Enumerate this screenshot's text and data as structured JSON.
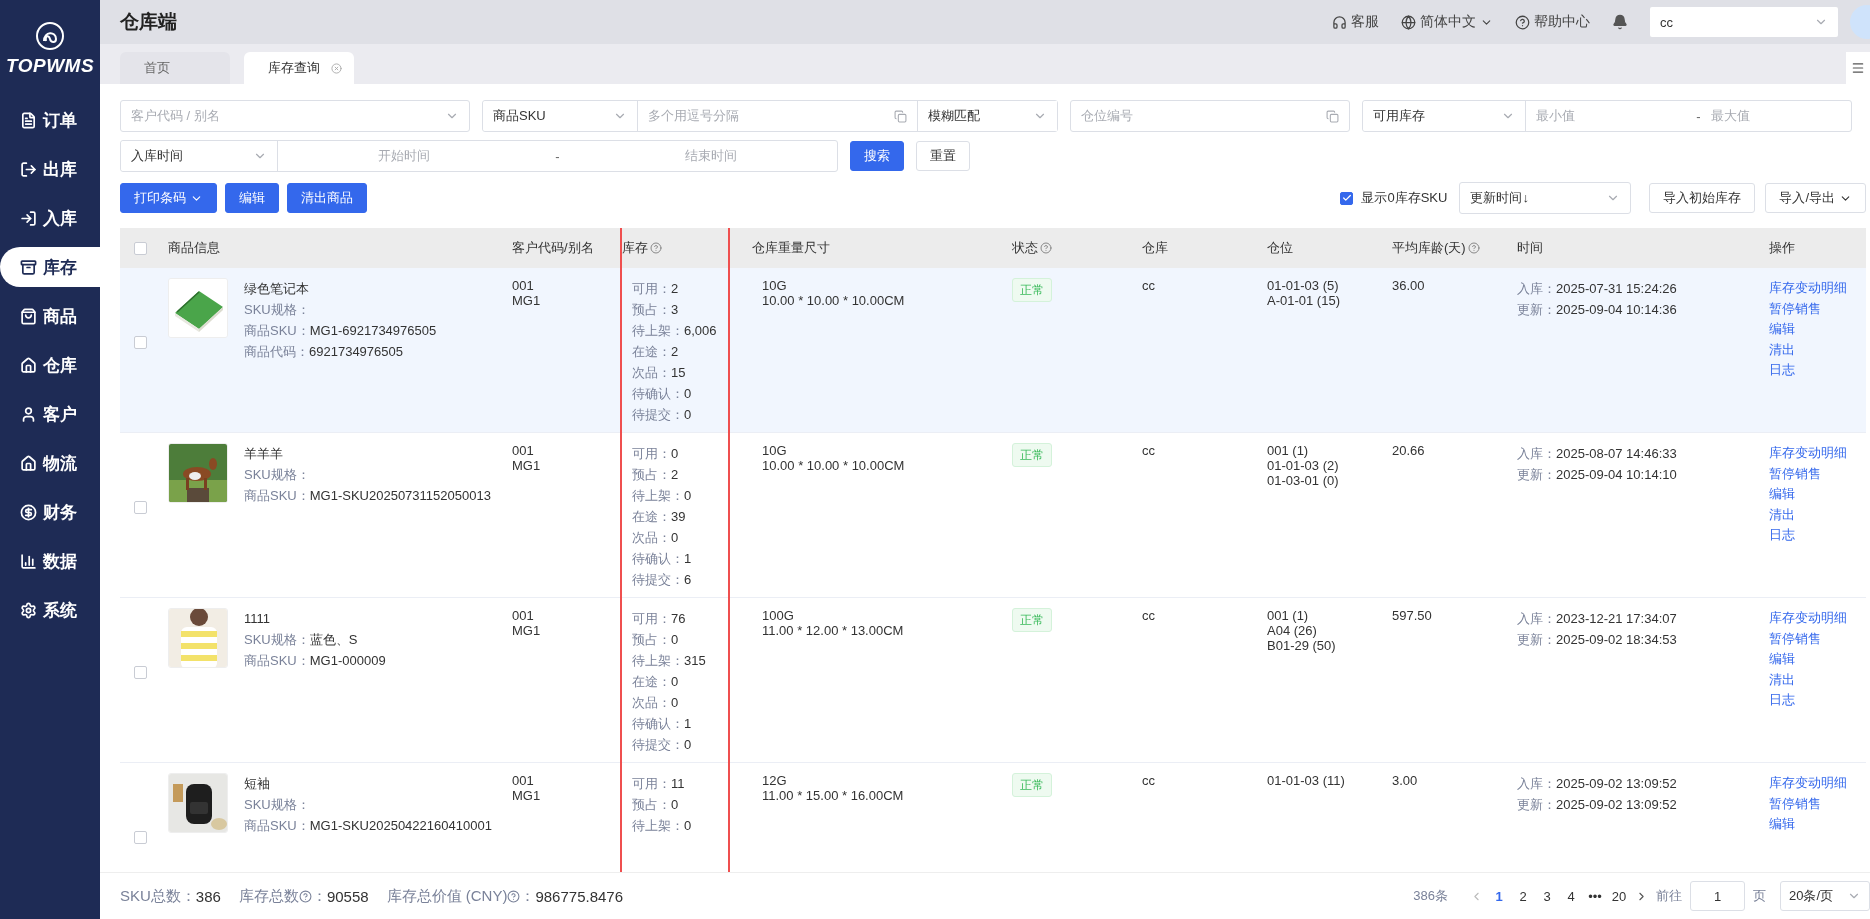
{
  "sidebar": {
    "logo": "TOPWMS",
    "items": [
      {
        "label": "订单",
        "selected": false
      },
      {
        "label": "出库",
        "selected": false
      },
      {
        "label": "入库",
        "selected": false
      },
      {
        "label": "库存",
        "selected": true
      },
      {
        "label": "商品",
        "selected": false
      },
      {
        "label": "仓库",
        "selected": false
      },
      {
        "label": "客户",
        "selected": false
      },
      {
        "label": "物流",
        "selected": false
      },
      {
        "label": "财务",
        "selected": false
      },
      {
        "label": "数据",
        "selected": false
      },
      {
        "label": "系统",
        "selected": false
      }
    ]
  },
  "header": {
    "title": "仓库端",
    "service": "客服",
    "language": "简体中文",
    "help": "帮助中心",
    "warehouse_select": {
      "value": "cc"
    }
  },
  "tabs": [
    {
      "label": "首页",
      "selected": false,
      "closable": false
    },
    {
      "label": "库存查询",
      "selected": true,
      "closable": true
    }
  ],
  "filters": {
    "customer": {
      "placeholder": "客户代码 / 别名"
    },
    "sku_type": {
      "value": "商品SKU"
    },
    "sku_input": {
      "placeholder": "多个用逗号分隔"
    },
    "match": {
      "value": "模糊匹配"
    },
    "location": {
      "placeholder": "仓位编号"
    },
    "stock_type": {
      "value": "可用库存"
    },
    "min": {
      "placeholder": "最小值"
    },
    "range_separator": "-",
    "max": {
      "placeholder": "最大值"
    },
    "date_type": {
      "value": "入库时间"
    },
    "start": {
      "placeholder": "开始时间"
    },
    "date_separator": "-",
    "end": {
      "placeholder": "结束时间"
    },
    "search_button": "搜索",
    "reset_button": "重置"
  },
  "toolbar": {
    "print_button": "打印条码",
    "edit_button": "编辑",
    "clear_button": "清出商品",
    "show_zero": {
      "label": "显示0库存SKU",
      "checked": true
    },
    "sort": {
      "value": "更新时间↓"
    },
    "import_initial_button": "导入初始库存",
    "import_export_button": "导入/导出"
  },
  "table": {
    "all_checked": false,
    "columns": [
      {
        "label": "商品信息",
        "help": false
      },
      {
        "label": "客户代码/别名",
        "help": false
      },
      {
        "label": "库存",
        "help": true
      },
      {
        "label": "仓库重量尺寸",
        "help": false
      },
      {
        "label": "状态",
        "help": true
      },
      {
        "label": "仓库",
        "help": false
      },
      {
        "label": "仓位",
        "help": false
      },
      {
        "label": "平均库龄(天)",
        "help": true
      },
      {
        "label": "时间",
        "help": false
      },
      {
        "label": "操作",
        "help": false
      }
    ],
    "rows": [
      {
        "highlighted": true,
        "checked": false,
        "product": {
          "name": "绿色笔记本",
          "lines": [
            {
              "label": "SKU规格："
            },
            {
              "label": "商品SKU：",
              "value": "MG1-6921734976505"
            },
            {
              "label": "商品代码：",
              "value": "6921734976505"
            }
          ]
        },
        "customer": [
          "001",
          "MG1"
        ],
        "stock": [
          {
            "label": "可用：",
            "value": "2"
          },
          {
            "label": "预占：",
            "value": "3"
          },
          {
            "label": "待上架：",
            "value": "6,006"
          },
          {
            "label": "在途：",
            "value": "2"
          },
          {
            "label": "次品：",
            "value": "15"
          },
          {
            "label": "待确认：",
            "value": "0"
          },
          {
            "label": "待提交：",
            "value": "0"
          }
        ],
        "weight": "10G",
        "dimensions": "10.00 * 10.00 * 10.00CM",
        "status": {
          "label": "正常",
          "kind": "normal"
        },
        "warehouse": "cc",
        "locations": [
          "01-01-03 (5)",
          "A-01-01 (15)"
        ],
        "age": "36.00",
        "times": [
          {
            "label": "入库：",
            "value": "2025-07-31 15:24:26"
          },
          {
            "label": "更新：",
            "value": "2025-09-04 10:14:36"
          }
        ],
        "actions": [
          "库存变动明细",
          "暂停销售",
          "编辑",
          "清出",
          "日志"
        ]
      },
      {
        "highlighted": false,
        "checked": false,
        "product": {
          "name": "羊羊羊",
          "lines": [
            {
              "label": "SKU规格："
            },
            {
              "label": "商品SKU：",
              "value": "MG1-SKU20250731152050013"
            }
          ]
        },
        "customer": [
          "001",
          "MG1"
        ],
        "stock": [
          {
            "label": "可用：",
            "value": "0"
          },
          {
            "label": "预占：",
            "value": "2"
          },
          {
            "label": "待上架：",
            "value": "0"
          },
          {
            "label": "在途：",
            "value": "39"
          },
          {
            "label": "次品：",
            "value": "0"
          },
          {
            "label": "待确认：",
            "value": "1"
          },
          {
            "label": "待提交：",
            "value": "6"
          }
        ],
        "weight": "10G",
        "dimensions": "10.00 * 10.00 * 10.00CM",
        "status": {
          "label": "正常",
          "kind": "normal"
        },
        "warehouse": "cc",
        "locations": [
          "001 (1)",
          "01-01-03 (2)",
          "01-03-01 (0)"
        ],
        "age": "20.66",
        "times": [
          {
            "label": "入库：",
            "value": "2025-08-07 14:46:33"
          },
          {
            "label": "更新：",
            "value": "2025-09-04 10:14:10"
          }
        ],
        "actions": [
          "库存变动明细",
          "暂停销售",
          "编辑",
          "清出",
          "日志"
        ]
      },
      {
        "highlighted": false,
        "checked": false,
        "product": {
          "name": "1111",
          "lines": [
            {
              "label": "SKU规格：",
              "value": "蓝色、S"
            },
            {
              "label": "商品SKU：",
              "value": "MG1-000009"
            }
          ]
        },
        "customer": [
          "001",
          "MG1"
        ],
        "stock": [
          {
            "label": "可用：",
            "value": "76"
          },
          {
            "label": "预占：",
            "value": "0"
          },
          {
            "label": "待上架：",
            "value": "315"
          },
          {
            "label": "在途：",
            "value": "0"
          },
          {
            "label": "次品：",
            "value": "0"
          },
          {
            "label": "待确认：",
            "value": "1"
          },
          {
            "label": "待提交：",
            "value": "0"
          }
        ],
        "weight": "100G",
        "dimensions": "11.00 * 12.00 * 13.00CM",
        "status": {
          "label": "正常",
          "kind": "normal"
        },
        "warehouse": "cc",
        "locations": [
          "001 (1)",
          "A04 (26)",
          "B01-29 (50)"
        ],
        "age": "597.50",
        "times": [
          {
            "label": "入库：",
            "value": "2023-12-21 17:34:07"
          },
          {
            "label": "更新：",
            "value": "2025-09-02 18:34:53"
          }
        ],
        "actions": [
          "库存变动明细",
          "暂停销售",
          "编辑",
          "清出",
          "日志"
        ]
      },
      {
        "highlighted": false,
        "checked": false,
        "product": {
          "name": "短袖",
          "lines": [
            {
              "label": "SKU规格："
            },
            {
              "label": "商品SKU：",
              "value": "MG1-SKU20250422160410001"
            }
          ]
        },
        "customer": [
          "001",
          "MG1"
        ],
        "stock": [
          {
            "label": "可用：",
            "value": "11"
          },
          {
            "label": "预占：",
            "value": "0"
          },
          {
            "label": "待上架：",
            "value": "0"
          }
        ],
        "weight": "12G",
        "dimensions": "11.00 * 15.00 * 16.00CM",
        "status": {
          "label": "正常",
          "kind": "normal"
        },
        "warehouse": "cc",
        "locations": [
          "01-01-03 (11)"
        ],
        "age": "3.00",
        "times": [
          {
            "label": "入库：",
            "value": "2025-09-02 13:09:52"
          },
          {
            "label": "更新：",
            "value": "2025-09-02 13:09:52"
          }
        ],
        "actions": [
          "库存变动明细",
          "暂停销售",
          "编辑"
        ]
      }
    ]
  },
  "footer": {
    "stats": [
      {
        "label": "SKU总数",
        "help": false,
        "separator": "：",
        "value": "386"
      },
      {
        "label": "库存总数",
        "help": true,
        "separator": "：",
        "value": "90558"
      },
      {
        "label": "库存总价值 (CNY)",
        "help": true,
        "separator": "：",
        "value": "986775.8476"
      }
    ],
    "pagination": {
      "total": "386条",
      "pages": [
        {
          "label": "1",
          "selected": true
        },
        {
          "label": "2",
          "selected": false
        },
        {
          "label": "3",
          "selected": false
        },
        {
          "label": "4",
          "selected": false
        }
      ],
      "more": "•••",
      "last": "20",
      "goto_label": "前往",
      "goto_value": "1",
      "page_unit": "页",
      "page_size": "20条/页"
    }
  }
}
